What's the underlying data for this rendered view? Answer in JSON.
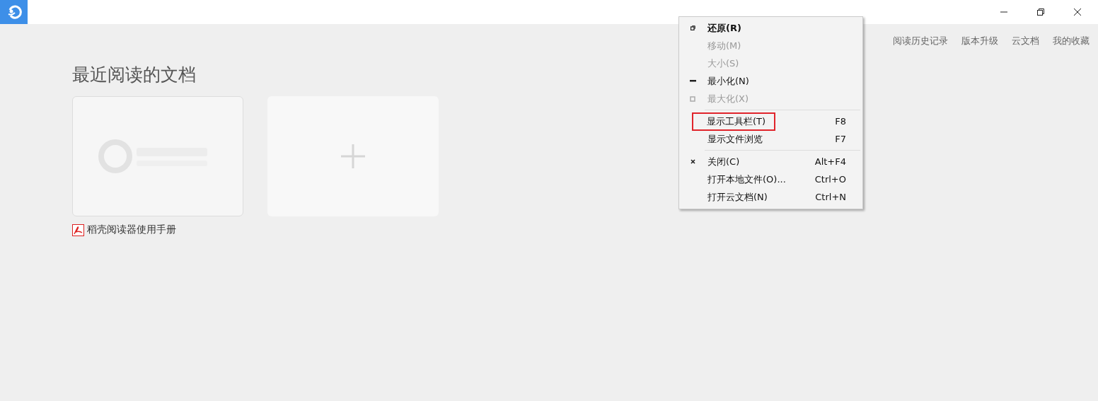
{
  "title_bar": {
    "controls": [
      {
        "kind": "minimize"
      },
      {
        "kind": "restore"
      },
      {
        "kind": "close"
      }
    ]
  },
  "top_links": [
    "阅读历史记录",
    "版本升级",
    "云文档",
    "我的收藏"
  ],
  "recent": {
    "title": "最近阅读的文档",
    "cards": [
      {
        "kind": "document"
      },
      {
        "kind": "add"
      }
    ],
    "files": [
      {
        "name": "稻壳阅读器使用手册"
      }
    ]
  },
  "context_menu": {
    "items": [
      {
        "kind": "restore",
        "label": "还原(R)",
        "disabled": false,
        "default": true,
        "highlighted": false
      },
      {
        "kind": "plain",
        "label": "移动(M)",
        "disabled": true,
        "default": false,
        "highlighted": false
      },
      {
        "kind": "plain",
        "label": "大小(S)",
        "disabled": true,
        "default": false,
        "highlighted": false
      },
      {
        "kind": "minimize",
        "label": "最小化(N)",
        "disabled": false,
        "default": false,
        "highlighted": false
      },
      {
        "kind": "maximize",
        "label": "最大化(X)",
        "disabled": true,
        "default": false,
        "highlighted": false
      },
      {
        "kind": "separator"
      },
      {
        "kind": "plain",
        "label": "显示工具栏(T)",
        "shortcut": "F8",
        "disabled": false,
        "default": false,
        "highlighted": true
      },
      {
        "kind": "plain",
        "label": "显示文件浏览",
        "shortcut": "F7",
        "disabled": false,
        "default": false,
        "highlighted": false
      },
      {
        "kind": "separator"
      },
      {
        "kind": "close",
        "label": "关闭(C)",
        "shortcut": "Alt+F4",
        "disabled": false,
        "default": false,
        "highlighted": false
      },
      {
        "kind": "plain",
        "label": "打开本地文件(O)...",
        "shortcut": "Ctrl+O",
        "disabled": false,
        "default": false,
        "highlighted": false
      },
      {
        "kind": "plain",
        "label": "打开云文档(N)",
        "shortcut": "Ctrl+N",
        "disabled": false,
        "default": false,
        "highlighted": false
      }
    ]
  }
}
